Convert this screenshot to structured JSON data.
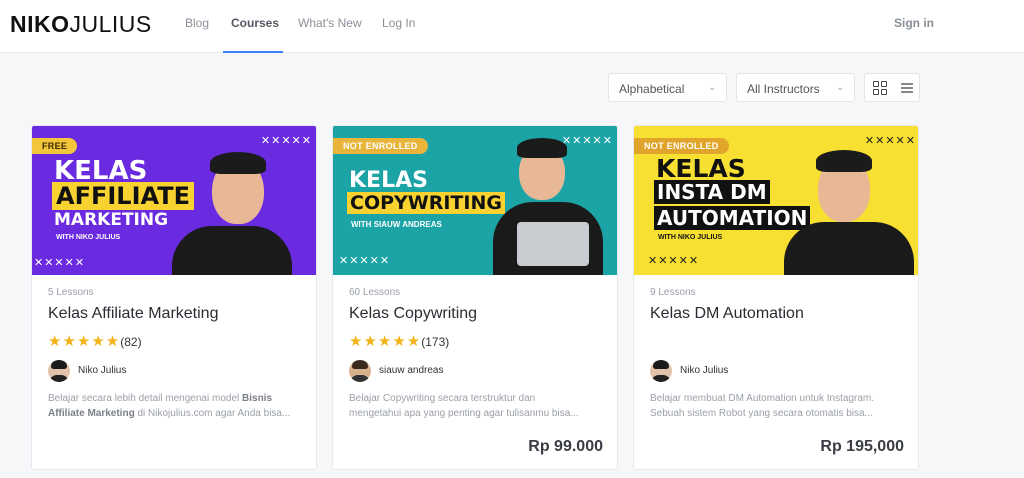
{
  "header": {
    "logo_bold": "NIKO",
    "logo_thin": "JULIUS",
    "nav": [
      "Blog",
      "Courses",
      "What's New",
      "Log In"
    ],
    "active_nav": "Courses",
    "signin": "Sign in"
  },
  "filters": {
    "sort": "Alphabetical",
    "instructor": "All Instructors",
    "view_icons": [
      "grid-icon",
      "list-icon"
    ]
  },
  "colors": {
    "accent": "#3b82f6",
    "badge_free": "#f3c53a",
    "badge_not_enrolled": "#e0a52a",
    "star": "#f2b21a"
  },
  "courses": [
    {
      "badge": "FREE",
      "banner_line1": "KELAS",
      "banner_line2": "AFFILIATE",
      "banner_line3": "MARKETING",
      "banner_sub": "WITH NIKO JULIUS",
      "lessons": "5 Lessons",
      "title": "Kelas Affiliate Marketing",
      "rating_count": "(82)",
      "rating_stars": 5,
      "author": "Niko Julius",
      "desc_pre": "Belajar secara lebih detail mengenai model ",
      "desc_bold1": "Bisnis",
      "desc_bold2": "Affiliate Marketing",
      "desc_post": " di Nikojulius.com agar Anda bisa...",
      "price": ""
    },
    {
      "badge": "NOT ENROLLED",
      "banner_line1": "KELAS",
      "banner_line2": "COPYWRITING",
      "banner_sub": "WITH SIAUW ANDREAS",
      "lessons": "60 Lessons",
      "title": "Kelas Copywriting",
      "rating_count": "(173)",
      "rating_stars": 5,
      "author": "siauw andreas",
      "desc_line1": "Belajar Copywriting secara terstruktur dan",
      "desc_line2": "mengetahui apa yang penting agar tulisanmu bisa...",
      "price": "Rp 99.000"
    },
    {
      "badge": "NOT ENROLLED",
      "banner_line1": "KELAS",
      "banner_line2": "INSTA DM",
      "banner_line3": "AUTOMATION",
      "banner_sub": "WITH NIKO JULIUS",
      "lessons": "9 Lessons",
      "title": "Kelas DM Automation",
      "author": "Niko Julius",
      "desc_line1": "Belajar membuat DM Automation untuk Instagram.",
      "desc_line2": "Sebuah sistem Robot yang secara otomatis bisa...",
      "price": "Rp 195,000"
    }
  ]
}
